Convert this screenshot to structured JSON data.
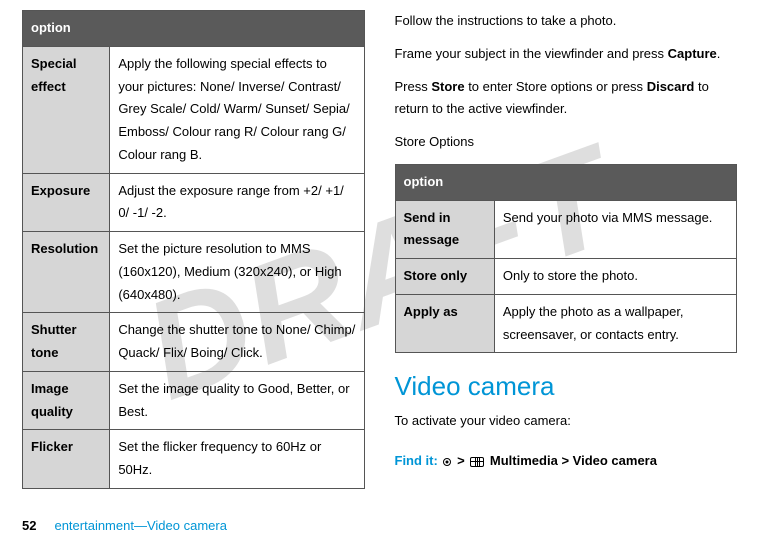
{
  "watermark": "DRAFT",
  "left_table": {
    "header": "option",
    "rows": [
      {
        "label": "Special effect",
        "desc": "Apply the following special effects to your pictures: None/ Inverse/ Contrast/ Grey Scale/ Cold/ Warm/ Sunset/ Sepia/ Emboss/ Colour rang R/ Colour rang G/ Colour rang B."
      },
      {
        "label": "Exposure",
        "desc": "Adjust the exposure range from +2/ +1/ 0/ -1/ -2."
      },
      {
        "label": "Resolution",
        "desc": "Set the picture resolution to MMS (160x120), Medium (320x240), or High (640x480)."
      },
      {
        "label": "Shutter tone",
        "desc": "Change the shutter tone to None/ Chimp/ Quack/ Flix/ Boing/ Click."
      },
      {
        "label": "Image quality",
        "desc": "Set the image quality to Good, Better, or Best."
      },
      {
        "label": "Flicker",
        "desc": "Set the flicker frequency to 60Hz or 50Hz."
      }
    ]
  },
  "right": {
    "para1": "Follow the instructions to take a photo.",
    "para2_a": "Frame your subject in the viewfinder and press ",
    "para2_b": "Capture",
    "para2_c": ".",
    "para3_a": "Press ",
    "para3_b": "Store",
    "para3_c": " to enter Store options or press ",
    "para3_d": "Discard",
    "para3_e": " to return to the active viewfinder.",
    "para4": "Store Options",
    "store_table": {
      "header": "option",
      "rows": [
        {
          "label": "Send in message",
          "desc": "Send your photo via MMS message."
        },
        {
          "label": "Store only",
          "desc": "Only to store the photo."
        },
        {
          "label": "Apply as",
          "desc": "Apply the photo as a wallpaper, screensaver, or contacts entry."
        }
      ]
    },
    "heading": "Video camera",
    "activate_text": "To activate your video camera:",
    "findit_label": "Find it: ",
    "gt": " > ",
    "multimedia": "Multimedia",
    "video_camera": "Video camera"
  },
  "footer": {
    "page_num": "52",
    "text": "entertainment—Video camera"
  }
}
